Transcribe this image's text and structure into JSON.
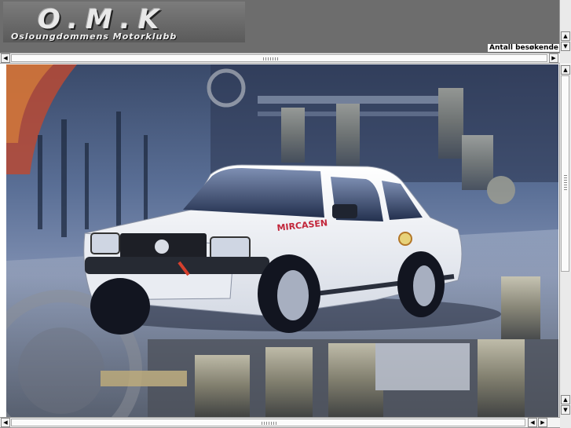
{
  "header": {
    "logo_title": "O.M.K",
    "logo_subtitle": "Osloungdommens Motorklubb",
    "visitor_counter_label": "Antall besøkende"
  },
  "main": {
    "image_sponsor_text": "MIRCASEN"
  },
  "colors": {
    "frame_gray": "#6d6d6d",
    "scene_blue": "#2c3f6b",
    "car_white": "#f2f2f2"
  },
  "icons": {
    "scroll_up": "arrow-up-icon",
    "scroll_down": "arrow-down-icon",
    "scroll_left": "arrow-left-icon",
    "scroll_right": "arrow-right-icon"
  }
}
